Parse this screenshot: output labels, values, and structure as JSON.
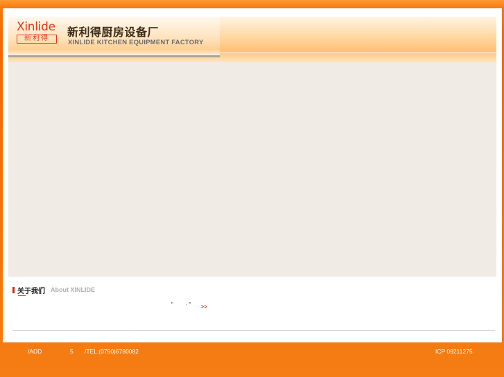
{
  "header": {
    "logo_word": "Xinlide",
    "logo_cn": "新利得",
    "company_cn": "新利得厨房设备厂",
    "company_en": "XINLIDE KITCHEN EQUIPMENT FACTORY"
  },
  "about": {
    "title_cn": "关于我们",
    "title_en": "About XINLIDE",
    "quote_open": "\"",
    "dot": "·",
    "quote_close": "\"",
    "more": ">>"
  },
  "footer": {
    "add": "/ADD",
    "num": "5",
    "tel": "/TEL:(0750)6780082",
    "icp": "ICP 09211275"
  },
  "colors": {
    "brand_orange": "#f27a10",
    "logo_red": "#e23b1a",
    "banner_bg": "#f0ebe4"
  }
}
